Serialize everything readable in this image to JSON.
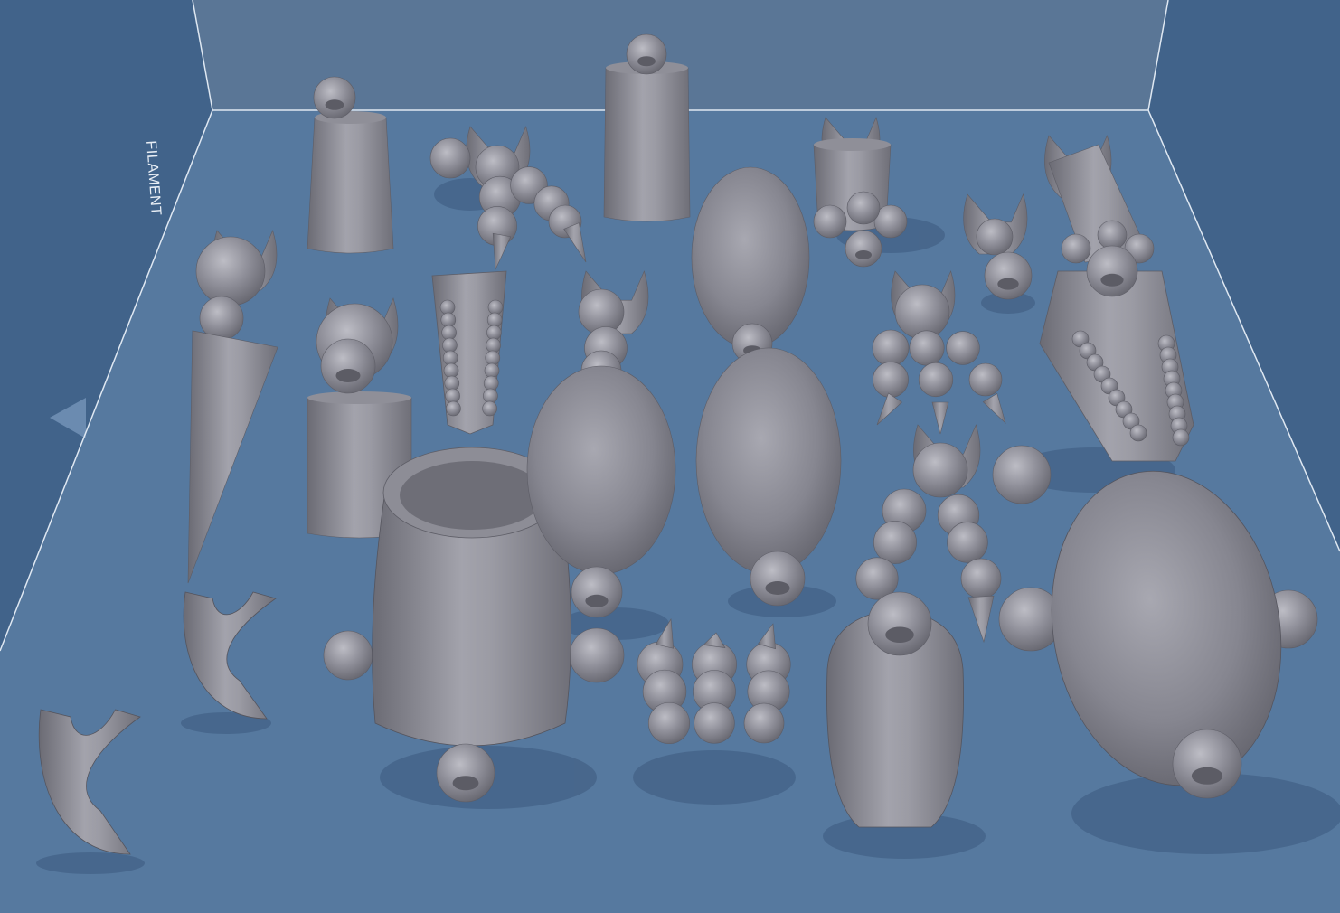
{
  "viewport": {
    "build_volume_label": "FILAMENT",
    "background_color": "#3f5f84",
    "bed_color": "#56799f",
    "back_wall_color": "#5a7696",
    "edge_line_color": "#dfe8f2",
    "model_color": "#8a8a93"
  },
  "models": [
    {
      "name": "bottle-part-1"
    },
    {
      "name": "curved-segmented-arm-1"
    },
    {
      "name": "bottle-part-2"
    },
    {
      "name": "ball-joint-arm-1"
    },
    {
      "name": "small-claw-connector"
    },
    {
      "name": "long-ball-joint-arm"
    },
    {
      "name": "cone-spike-part"
    },
    {
      "name": "bottle-part-3"
    },
    {
      "name": "jaw-part-left"
    },
    {
      "name": "segmented-leg-1"
    },
    {
      "name": "large-oval-body"
    },
    {
      "name": "segmented-claw-leg"
    },
    {
      "name": "jaw-part-right"
    },
    {
      "name": "large-barrel-body"
    },
    {
      "name": "egg-body-left"
    },
    {
      "name": "egg-body-right"
    },
    {
      "name": "segmented-leg-2"
    },
    {
      "name": "claw-piece-1"
    },
    {
      "name": "claw-piece-2"
    },
    {
      "name": "claw-cluster"
    },
    {
      "name": "bottle-part-4"
    },
    {
      "name": "large-egg-body-right"
    }
  ]
}
